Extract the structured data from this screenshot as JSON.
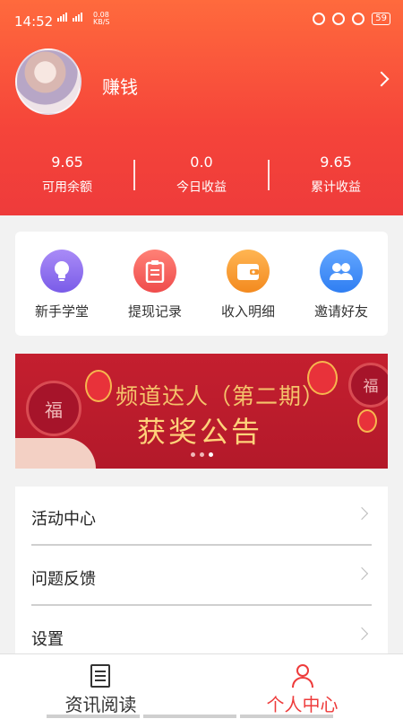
{
  "status_bar": {
    "time": "14:52",
    "network_speed": "0.08",
    "speed_unit": "KB/S",
    "battery": "59"
  },
  "profile": {
    "name": "赚钱"
  },
  "stats": [
    {
      "value": "9.65",
      "label": "可用余额"
    },
    {
      "value": "0.0",
      "label": "今日收益"
    },
    {
      "value": "9.65",
      "label": "累计收益"
    }
  ],
  "tools": [
    {
      "label": "新手学堂",
      "icon": "lightbulb-icon",
      "color": "#8b6cf0"
    },
    {
      "label": "提现记录",
      "icon": "clipboard-icon",
      "color": "#f25f5c"
    },
    {
      "label": "收入明细",
      "icon": "wallet-icon",
      "color": "#f7982f"
    },
    {
      "label": "邀请好友",
      "icon": "friends-icon",
      "color": "#3d8af7"
    }
  ],
  "banner": {
    "line1": "频道达人（第二期）",
    "line2": "获奖公告",
    "medal_char": "福",
    "active_dot": 2,
    "dot_count": 3
  },
  "menu": [
    {
      "label": "活动中心"
    },
    {
      "label": "问题反馈"
    },
    {
      "label": "设置"
    }
  ],
  "tabs": [
    {
      "label": "资讯阅读",
      "icon": "news-icon",
      "active": false
    },
    {
      "label": "个人中心",
      "icon": "person-icon",
      "active": true
    }
  ],
  "colors": {
    "accent": "#ee3b3b",
    "header_top": "#ff6a3d",
    "banner_bg": "#c41f2f"
  }
}
